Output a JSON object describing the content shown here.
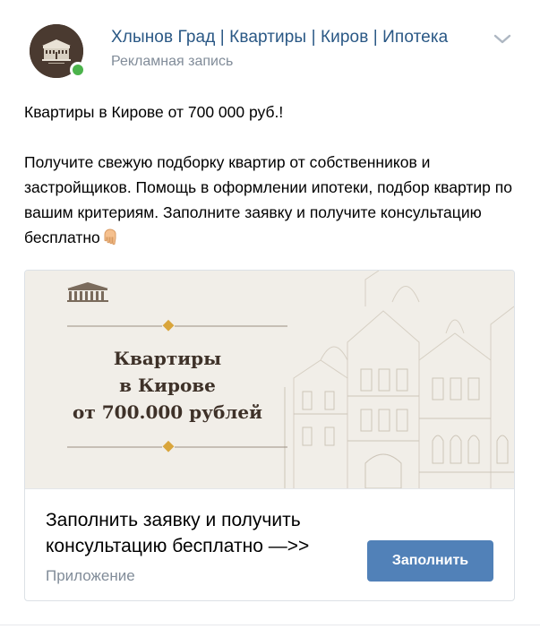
{
  "header": {
    "author": "Хлынов Град | Квартиры | Киров | Ипотека",
    "subtitle": "Рекламная запись",
    "avatar_icon": "building-logo-icon",
    "menu_icon": "chevron-down-icon"
  },
  "post": {
    "line1": "Квартиры в Кирове от 700 000 руб.!",
    "paragraph2": "Получите свежую подборку квартир от собственников и застройщиков. Помощь в оформлении ипотеки, подбор квартир по вашим критериям. Заполните заявку и получите консультацию бесплатно",
    "emoji_icon": "pointing-down-hand-icon"
  },
  "ad": {
    "banner_lines": [
      "Квартиры",
      "в Кирове",
      "от 700.000 рублей"
    ],
    "cta_title_lines": [
      "Заполнить заявку и получить",
      "консультацию бесплатно —>>"
    ],
    "cta_subtitle": "Приложение",
    "button_label": "Заполнить"
  },
  "colors": {
    "link": "#2a5885",
    "muted": "#818c99",
    "button": "#5181b8",
    "online": "#4bb34b",
    "banner_bg": "#f1eee8",
    "banner_text": "#3e3128",
    "ornament": "#d9a53b"
  }
}
